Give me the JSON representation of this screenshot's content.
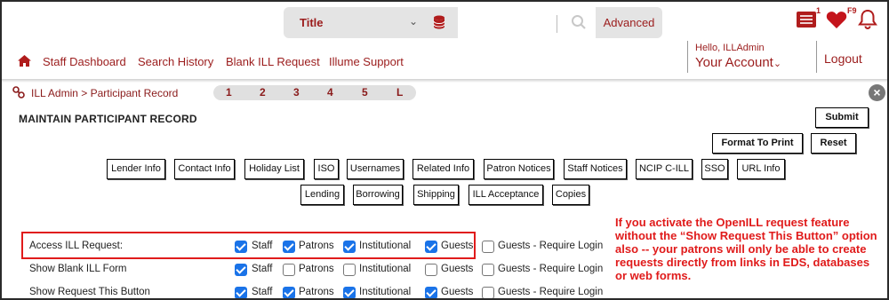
{
  "header": {
    "search_scope": "Title",
    "advanced_label": "Advanced",
    "notifications_badge": "1",
    "favorites_badge": "F9",
    "hello_text": "Hello, ILLAdmin",
    "account_label": "Your Account",
    "logout_label": "Logout"
  },
  "nav": {
    "items": [
      "Staff Dashboard",
      "Search History",
      "Blank ILL Request",
      "Illume Support"
    ]
  },
  "breadcrumb": "ILL Admin > Participant Record",
  "page_tabs": [
    "1",
    "2",
    "3",
    "4",
    "5",
    "L"
  ],
  "page_title": "MAINTAIN PARTICIPANT RECORD",
  "action_buttons": {
    "submit": "Submit",
    "format_print": "Format To Print",
    "reset": "Reset"
  },
  "section_buttons_row1": [
    "Lender Info",
    "Contact Info",
    "Holiday List",
    "ISO",
    "Usernames",
    "Related Info",
    "Patron Notices",
    "Staff Notices",
    "NCIP C-ILL",
    "SSO",
    "URL Info"
  ],
  "section_buttons_row2": [
    "Lending",
    "Borrowing",
    "Shipping",
    "ILL Acceptance",
    "Copies"
  ],
  "option_labels": [
    "Staff",
    "Patrons",
    "Institutional",
    "Guests",
    "Guests - Require Login"
  ],
  "settings": [
    {
      "label": "Access ILL Request:",
      "checked": [
        true,
        true,
        true,
        true,
        false
      ]
    },
    {
      "label": "Show Blank ILL Form",
      "checked": [
        true,
        false,
        false,
        false,
        false
      ]
    },
    {
      "label": "Show Request This Button",
      "checked": [
        true,
        true,
        true,
        true,
        false
      ]
    }
  ],
  "note": "If you activate the OpenILL request feature without the “Show Request This Button” option also -- your patrons will only be able to create requests directly from links in EDS, databases or web forms.",
  "colors": {
    "accent": "#9b1c1c",
    "annotation": "#e01b1b",
    "checkbox_on": "#1a73e8"
  }
}
